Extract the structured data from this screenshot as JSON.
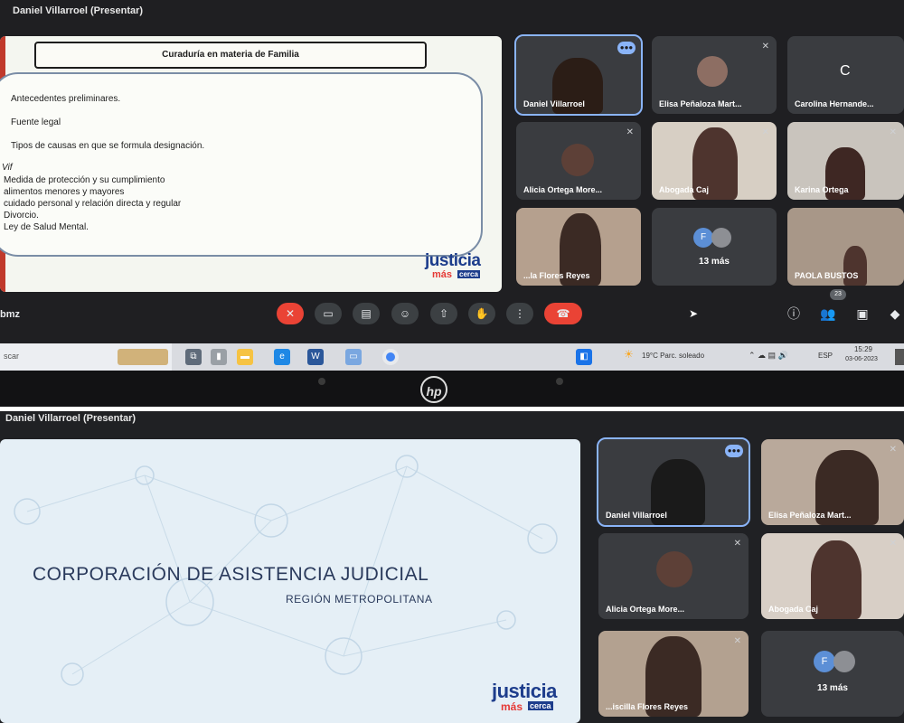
{
  "top": {
    "presenter": "Daniel Villarroel (Presentar)",
    "slide": {
      "title": "Curaduría en materia de Familia",
      "items": [
        "Antecedentes preliminares.",
        "Fuente legal",
        "Tipos de causas en que se formula designación."
      ],
      "mark": "Vif",
      "subitems": [
        "Medida de protección y su cumplimiento",
        "alimentos menores y mayores",
        "cuidado personal y relación directa y regular",
        "Divorcio.",
        "Ley de Salud Mental."
      ],
      "logo_justicia": "justicia",
      "logo_mas": "más",
      "logo_cerca": "cerca"
    },
    "participants": [
      {
        "name": "Daniel Villarroel"
      },
      {
        "name": "Elisa Peñaloza Mart..."
      },
      {
        "name": "Carolina Hernande...",
        "initial": "C"
      },
      {
        "name": "Alicia Ortega More..."
      },
      {
        "name": "Abogada Caj"
      },
      {
        "name": "Karina Ortega"
      },
      {
        "name": "...la Flores Reyes"
      },
      {
        "name": "13 más",
        "initial": "F"
      },
      {
        "name": "PAOLA BUSTOS"
      }
    ],
    "meeting_code": "bmz",
    "participants_count": "23",
    "search_placeholder": "scar",
    "weather": "19°C  Parc. soleado",
    "lang": "ESP",
    "time": "15:29",
    "date": "03-06-2023",
    "brand": "hp"
  },
  "bottom": {
    "presenter": "Daniel Villarroel (Presentar)",
    "slide": {
      "title": "CORPORACIÓN DE ASISTENCIA JUDICIAL",
      "subtitle": "REGIÓN METROPOLITANA",
      "logo_justicia": "justicia",
      "logo_mas": "más",
      "logo_cerca": "cerca"
    },
    "participants": [
      {
        "name": "Daniel Villarroel"
      },
      {
        "name": "Elisa Peñaloza Mart..."
      },
      {
        "name": "Alicia Ortega More..."
      },
      {
        "name": "Abogada Caj"
      },
      {
        "name": "...iscilla Flores Reyes"
      },
      {
        "name": "13 más",
        "initial": "F"
      }
    ]
  },
  "colors": {
    "meet_bg": "#202124",
    "end_call": "#ea4335",
    "active_speaker": "#8ab4f8",
    "logo_blue": "#1d3d8c",
    "logo_red": "#e53935"
  }
}
